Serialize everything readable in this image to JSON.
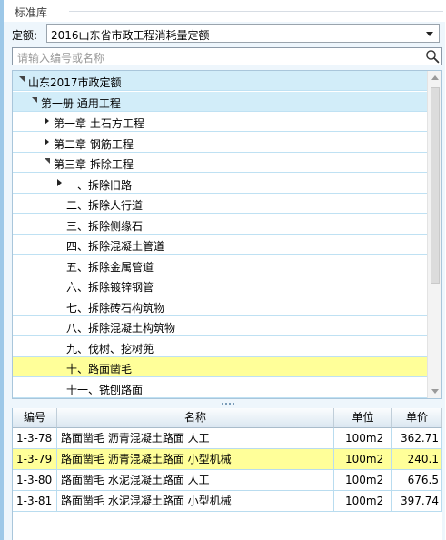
{
  "panel": {
    "title": "标准库"
  },
  "quota": {
    "label": "定额:",
    "selected": "2016山东省市政工程消耗量定额"
  },
  "search": {
    "placeholder": "请输入编号或名称"
  },
  "tree": {
    "items": [
      {
        "label": "山东2017市政定额",
        "expander": "down",
        "state": "selected"
      },
      {
        "label": "第一册 通用工程",
        "expander": "down",
        "state": "selected"
      },
      {
        "label": "第一章 土石方工程",
        "expander": "right",
        "state": "normal"
      },
      {
        "label": "第二章 钢筋工程",
        "expander": "right",
        "state": "normal"
      },
      {
        "label": "第三章 拆除工程",
        "expander": "down",
        "state": "normal"
      },
      {
        "label": "一、拆除旧路",
        "expander": "right",
        "state": "normal"
      },
      {
        "label": "二、拆除人行道",
        "expander": "none",
        "state": "normal"
      },
      {
        "label": "三、拆除侧缘石",
        "expander": "none",
        "state": "normal"
      },
      {
        "label": "四、拆除混凝土管道",
        "expander": "none",
        "state": "normal"
      },
      {
        "label": "五、拆除金属管道",
        "expander": "none",
        "state": "normal"
      },
      {
        "label": "六、拆除镀锌钢管",
        "expander": "none",
        "state": "normal"
      },
      {
        "label": "七、拆除砖石构筑物",
        "expander": "none",
        "state": "normal"
      },
      {
        "label": "八、拆除混凝土构筑物",
        "expander": "none",
        "state": "normal"
      },
      {
        "label": "九、伐树、挖树蔸",
        "expander": "none",
        "state": "normal"
      },
      {
        "label": "十、路面凿毛",
        "expander": "none",
        "state": "highlighted"
      },
      {
        "label": "十一、铣刨路面",
        "expander": "none",
        "state": "normal"
      }
    ]
  },
  "table": {
    "headers": {
      "code": "编号",
      "name": "名称",
      "unit": "单位",
      "price": "单价"
    },
    "rows": [
      {
        "code": "1-3-78",
        "name": "路面凿毛 沥青混凝土路面 人工",
        "unit": "100m2",
        "price": "362.71",
        "state": "normal"
      },
      {
        "code": "1-3-79",
        "name": "路面凿毛 沥青混凝土路面 小型机械",
        "unit": "100m2",
        "price": "240.1",
        "state": "highlighted"
      },
      {
        "code": "1-3-80",
        "name": "路面凿毛 水泥混凝土路面 人工",
        "unit": "100m2",
        "price": "676.5",
        "state": "normal"
      },
      {
        "code": "1-3-81",
        "name": "路面凿毛 水泥混凝土路面 小型机械",
        "unit": "100m2",
        "price": "397.74",
        "state": "normal"
      }
    ]
  },
  "colors": {
    "selected_row": "#d2edf9",
    "highlight_row": "#ffff99",
    "grid_line": "#bfe1f3",
    "panel_background": "#eef6fc"
  }
}
